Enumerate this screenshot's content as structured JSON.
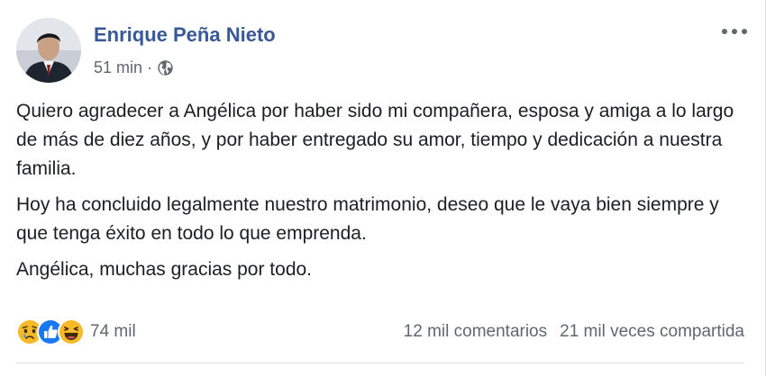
{
  "post": {
    "author": "Enrique Peña Nieto",
    "time": "51 min",
    "separator": "·",
    "privacy_icon": "globe-icon",
    "more_icon": "more-options-icon",
    "paragraphs": [
      "Quiero agradecer a Angélica por haber sido mi compañera, esposa y amiga a lo largo de más de diez años, y por haber entregado su amor, tiempo y dedicación a nuestra familia.",
      "Hoy ha concluido legalmente nuestro matrimonio, deseo que le vaya bien siempre y que tenga éxito en todo lo que emprenda.",
      "Angélica, muchas gracias por todo."
    ]
  },
  "footer": {
    "reaction_icons": [
      "sad-reaction-icon",
      "like-reaction-icon",
      "haha-reaction-icon"
    ],
    "reaction_count": "74 mil",
    "comments": "12 mil comentarios",
    "shares": "21 mil veces compartida"
  },
  "colors": {
    "author": "#385898",
    "meta": "#606770",
    "text": "#1c1e21",
    "like_blue": "#1877f2",
    "reaction_yellow": "#f7b928"
  }
}
